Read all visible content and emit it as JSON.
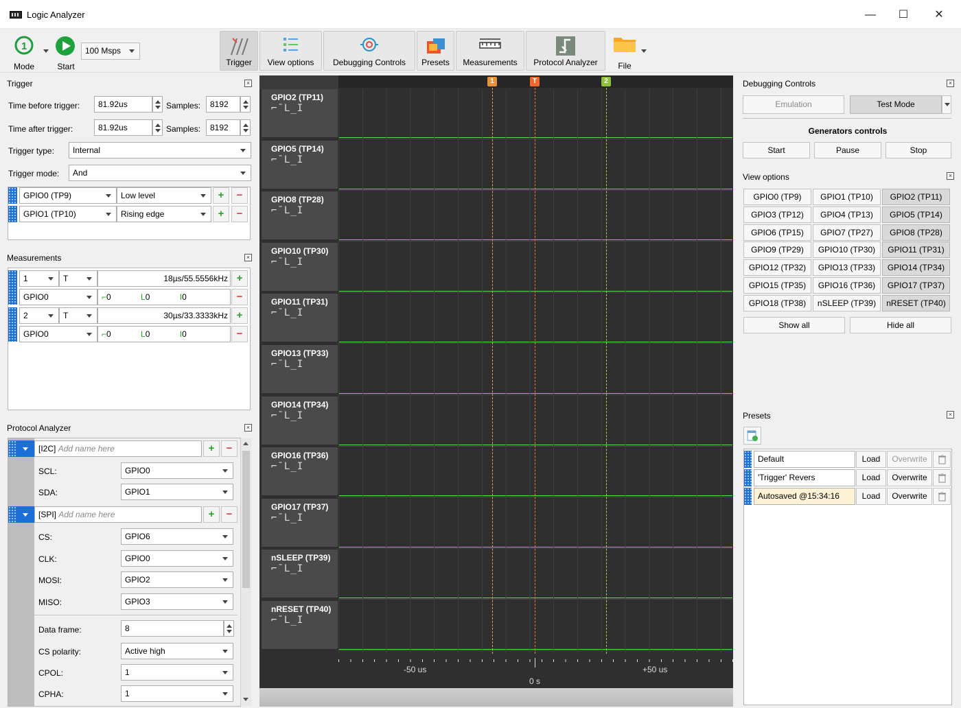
{
  "window": {
    "title": "Logic Analyzer"
  },
  "toolbar": {
    "mode": "Mode",
    "start": "Start",
    "rate": "100 Msps",
    "trigger": "Trigger",
    "view_options": "View options",
    "debugging_controls": "Debugging Controls",
    "presets": "Presets",
    "measurements": "Measurements",
    "protocol_analyzer": "Protocol Analyzer",
    "file": "File"
  },
  "trigger": {
    "title": "Trigger",
    "time_before_label": "Time before trigger:",
    "time_before": "81.92us",
    "samples_label": "Samples:",
    "samples_before": "8192",
    "time_after_label": "Time after trigger:",
    "time_after": "81.92us",
    "samples_after": "8192",
    "type_label": "Trigger type:",
    "type": "Internal",
    "mode_label": "Trigger mode:",
    "mode": "And",
    "conditions": [
      {
        "pin": "GPIO0 (TP9)",
        "cond": "Low level"
      },
      {
        "pin": "GPIO1 (TP10)",
        "cond": "Rising edge"
      }
    ]
  },
  "measurements": {
    "title": "Measurements",
    "items": [
      {
        "num": "1",
        "marker": "T",
        "value": "18µs/55.5556kHz",
        "pin": "GPIO0",
        "rise": "0",
        "fall": "0",
        "pulse": "0"
      },
      {
        "num": "2",
        "marker": "T",
        "value": "30µs/33.3333kHz",
        "pin": "GPIO0",
        "rise": "0",
        "fall": "0",
        "pulse": "0"
      }
    ]
  },
  "protocol": {
    "title": "Protocol Analyzer",
    "placeholder": "Add name here",
    "i2c_tag": "[I2C]",
    "spi_tag": "[SPI]",
    "i2c": [
      {
        "label": "SCL:",
        "value": "GPIO0"
      },
      {
        "label": "SDA:",
        "value": "GPIO1"
      }
    ],
    "spi": [
      {
        "label": "CS:",
        "value": "GPIO6"
      },
      {
        "label": "CLK:",
        "value": "GPIO0"
      },
      {
        "label": "MOSI:",
        "value": "GPIO2"
      },
      {
        "label": "MISO:",
        "value": "GPIO3"
      }
    ],
    "data_frame_label": "Data frame:",
    "data_frame": "8",
    "cs_pol_label": "CS polarity:",
    "cs_pol": "Active high",
    "cpol_label": "CPOL:",
    "cpol": "1",
    "cpha_label": "CPHA:",
    "cpha": "1"
  },
  "channels": [
    {
      "name": "GPIO2 (TP11)"
    },
    {
      "name": "GPIO5 (TP14)"
    },
    {
      "name": "GPIO8 (TP28)"
    },
    {
      "name": "GPIO10 (TP30)"
    },
    {
      "name": "GPIO11 (TP31)"
    },
    {
      "name": "GPIO13 (TP33)"
    },
    {
      "name": "GPIO14 (TP34)"
    },
    {
      "name": "GPIO16 (TP36)"
    },
    {
      "name": "GPIO17 (TP37)"
    },
    {
      "name": "nSLEEP (TP39)"
    },
    {
      "name": "nRESET (TP40)"
    }
  ],
  "wave": {
    "symbols": "⌐¯L_I",
    "marker1": "1",
    "marker_t": "T",
    "marker2": "2",
    "tick_neg": "-50 us",
    "tick_zero": "0 s",
    "tick_pos": "+50 us"
  },
  "debug": {
    "title": "Debugging Controls",
    "emulation": "Emulation",
    "test_mode": "Test Mode",
    "generators": "Generators controls",
    "start": "Start",
    "pause": "Pause",
    "stop": "Stop"
  },
  "view": {
    "title": "View options",
    "gpios": [
      "GPIO0 (TP9)",
      "GPIO1 (TP10)",
      "GPIO2 (TP11)",
      "GPIO3 (TP12)",
      "GPIO4 (TP13)",
      "GPIO5 (TP14)",
      "GPIO6 (TP15)",
      "GPIO7 (TP27)",
      "GPIO8 (TP28)",
      "GPIO9 (TP29)",
      "GPIO10 (TP30)",
      "GPIO11 (TP31)",
      "GPIO12 (TP32)",
      "GPIO13 (TP33)",
      "GPIO14 (TP34)",
      "GPIO15 (TP35)",
      "GPIO16 (TP36)",
      "GPIO17 (TP37)",
      "GPIO18 (TP38)",
      "nSLEEP (TP39)",
      "nRESET (TP40)"
    ],
    "show_all": "Show all",
    "hide_all": "Hide all"
  },
  "presets": {
    "title": "Presets",
    "load": "Load",
    "overwrite": "Overwrite",
    "items": [
      {
        "name": "Default"
      },
      {
        "name": "'Trigger' Revers"
      },
      {
        "name": "Autosaved  @15:34:16"
      }
    ]
  }
}
